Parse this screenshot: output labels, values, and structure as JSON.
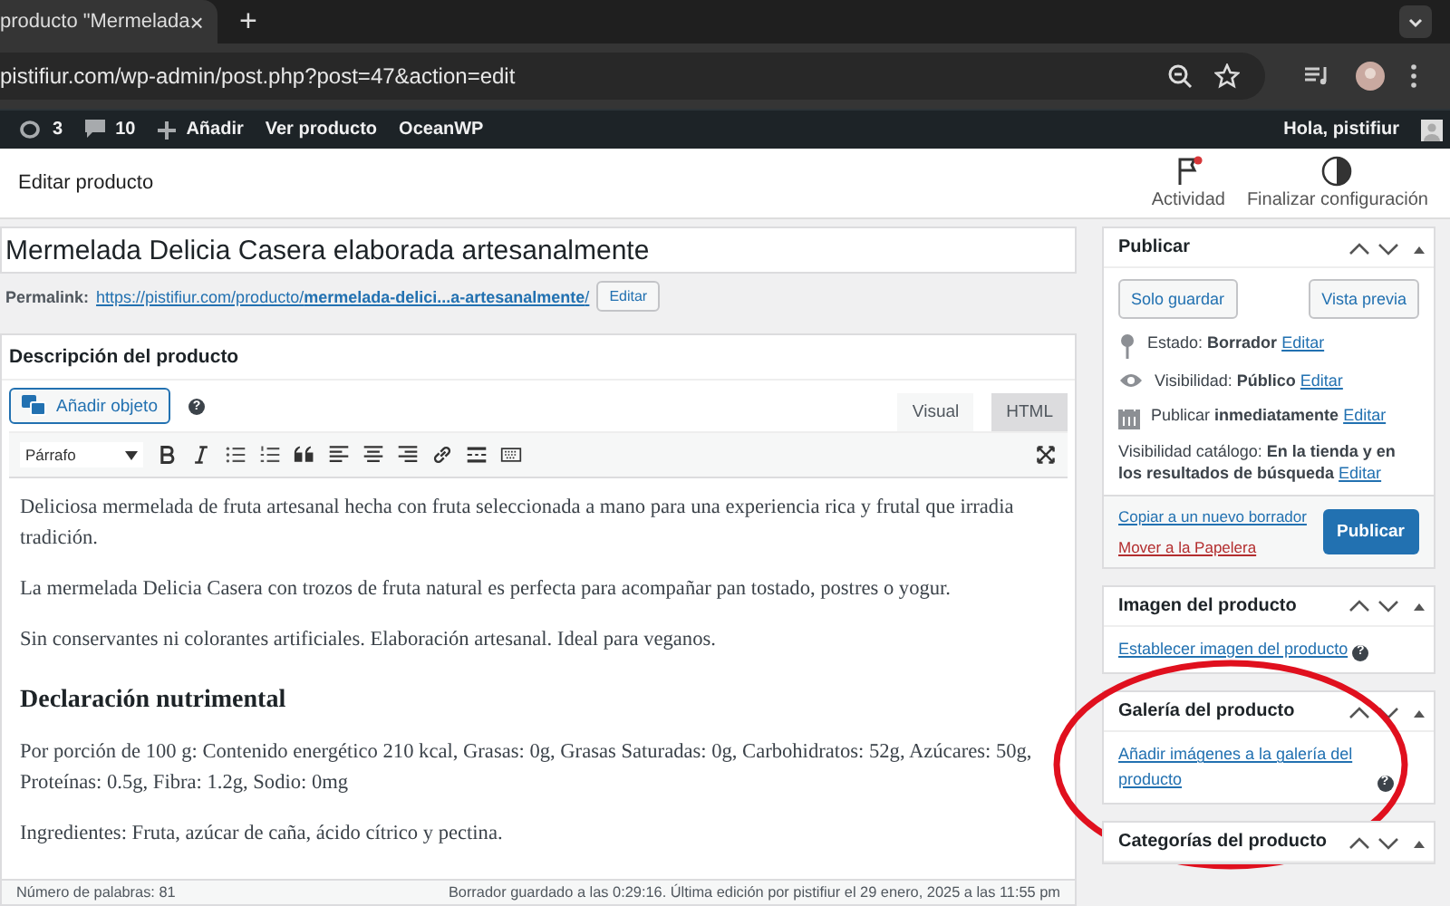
{
  "browser": {
    "tab_title": "producto \"Mermelada",
    "tab_close": "×",
    "new_tab": "+",
    "url": "pistifiur.com/wp-admin/post.php?post=47&action=edit"
  },
  "admin_bar": {
    "updates": "3",
    "comments": "10",
    "new": "Añadir",
    "links": [
      "Ver producto",
      "OceanWP"
    ],
    "greeting": "Hola, pistifiur"
  },
  "header": {
    "title": "Editar producto",
    "actions": [
      {
        "label": "Actividad",
        "kind": "flag",
        "notify": true
      },
      {
        "label": "Finalizar configuración",
        "kind": "halfcircle",
        "notify": false
      }
    ]
  },
  "post_title": "Mermelada Delicia Casera elaborada artesanalmente",
  "permalink": {
    "label": "Permalink:",
    "url": "https://pistifiur.com/producto/**mermelada-delici...a-artesanalmente**/",
    "button": "Editar"
  },
  "editor": {
    "title": "Descripción del producto",
    "add_media": "Añadir objeto",
    "help": "?",
    "tabs": [
      {
        "label": "Visual",
        "selected": true
      },
      {
        "label": "HTML",
        "selected": false
      }
    ],
    "format": "Párrafo",
    "content": [
      {
        "kind": "paragraph",
        "text": "Deliciosa mermelada de fruta artesanal hecha con fruta seleccionada a mano para una experiencia rica y frutal que irradia tradición."
      },
      {
        "kind": "paragraph",
        "text": "La mermelada Delicia Casera con trozos de fruta natural es perfecta para acompañar pan tostado, postres o yogur."
      },
      {
        "kind": "paragraph",
        "text": "Sin conservantes ni colorantes artificiales. Elaboración artesanal. Ideal para veganos."
      },
      {
        "kind": "heading",
        "text": "Declaración nutrimental"
      },
      {
        "kind": "paragraph",
        "text": "Por porción de 100 g: Contenido energético 210 kcal, Grasas: 0g, Grasas Saturadas: 0g, Carbohidratos: 52g, Azúcares: 50g, Proteínas: 0.5g, Fibra: 1.2g, Sodio: 0mg"
      },
      {
        "kind": "paragraph",
        "text": "Ingredientes: Fruta, azúcar de caña, ácido cítrico y pectina."
      }
    ],
    "word_count": "Número de palabras: 81",
    "saved": "Borrador guardado a las 0:29:16. Última edición por pistifiur el 29 enero, 2025 a las 11:55 pm"
  },
  "publish_box": {
    "title": "Publicar",
    "save": "Solo guardar",
    "preview": "Vista previa",
    "rows": [
      {
        "kind": "pin",
        "text": "Estado: **Borrador**",
        "link": "Editar"
      },
      {
        "kind": "eye",
        "text": "Visibilidad: **Público**",
        "link": "Editar"
      },
      {
        "kind": "calendar",
        "text": "Publicar **inmediatamente**",
        "link": "Editar"
      },
      {
        "kind": "none",
        "text": "Visibilidad catálogo: **En la tienda y en los resultados de búsqueda**",
        "link": "Editar"
      }
    ],
    "copy": "Copiar a un nuevo borrador",
    "trash": "Mover a la Papelera",
    "publish": "Publicar"
  },
  "boxes": [
    {
      "title": "Imagen del producto",
      "link": "Establecer imagen del producto",
      "help": "?",
      "highlighted": false
    },
    {
      "title": "Galería del producto",
      "link": "Añadir imágenes a la galería del producto",
      "help": "?",
      "highlighted": true
    },
    {
      "title": "Categorías del producto",
      "highlighted": false
    }
  ]
}
